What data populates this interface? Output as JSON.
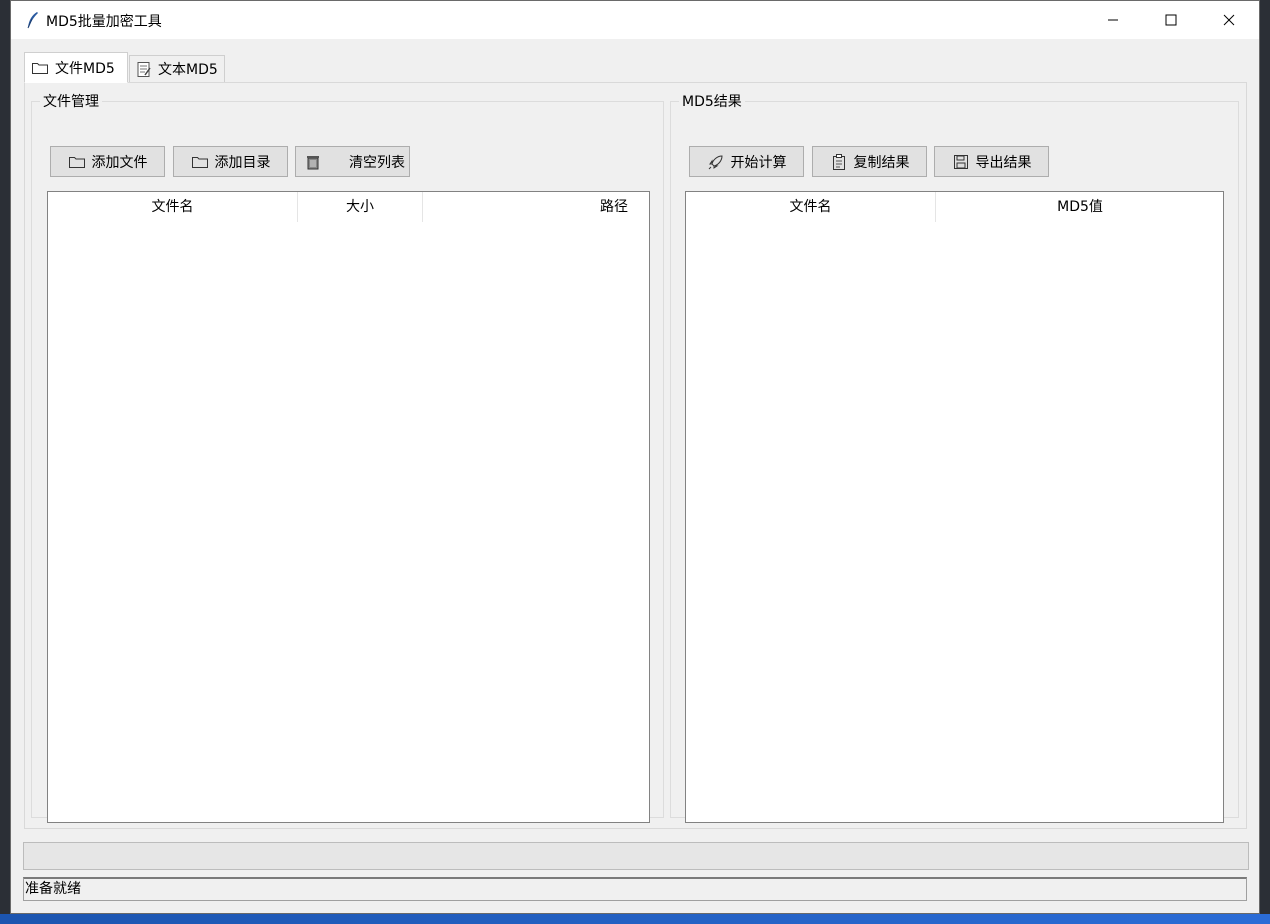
{
  "window": {
    "title": "MD5批量加密工具"
  },
  "tabs": [
    {
      "label": "文件MD5",
      "icon": "folder-icon"
    },
    {
      "label": "文本MD5",
      "icon": "notepad-icon"
    }
  ],
  "file_panel": {
    "title": "文件管理",
    "buttons": {
      "add_file": "添加文件",
      "add_dir": "添加目录",
      "clear": "清空列表"
    },
    "columns": [
      "文件名",
      "大小",
      "路径"
    ]
  },
  "result_panel": {
    "title": "MD5结果",
    "buttons": {
      "start": "开始计算",
      "copy": "复制结果",
      "export": "导出结果"
    },
    "columns": [
      "文件名",
      "MD5值"
    ]
  },
  "progress": {
    "value": 0
  },
  "status": {
    "text": "准备就绪"
  }
}
